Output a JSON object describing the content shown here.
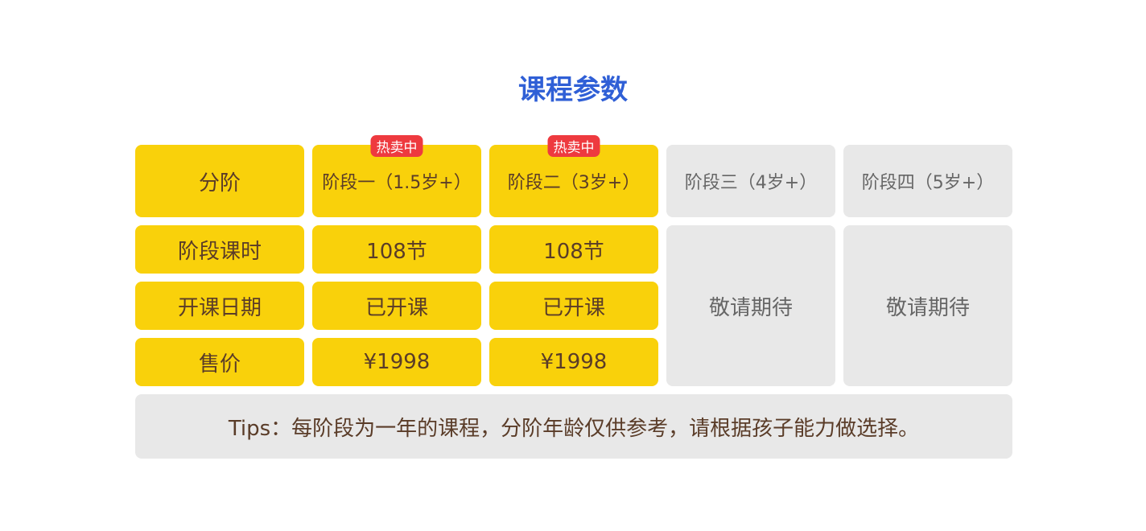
{
  "title": "课程参数",
  "badge": "热卖中",
  "header": [
    "分阶",
    "阶段一（1.5岁+）",
    "阶段二（3岁+）",
    "阶段三（4岁+）",
    "阶段四（5岁+）"
  ],
  "rows": [
    {
      "label": "阶段课时",
      "values": [
        "108节",
        "108节"
      ]
    },
    {
      "label": "开课日期",
      "values": [
        "已开课",
        "已开课"
      ]
    },
    {
      "label": "售价",
      "values": [
        "¥1998",
        "¥1998"
      ]
    }
  ],
  "coming_soon": [
    "敬请期待",
    "敬请期待"
  ],
  "tips": "Tips：每阶段为一年的课程，分阶年龄仅供参考，请根据孩子能力做选择。",
  "colors": {
    "yellow": "#f9d10b",
    "grey": "#e8e8e8",
    "badge": "#ee3a3f",
    "title": "#2f5fd6",
    "text": "#5a3c28"
  }
}
